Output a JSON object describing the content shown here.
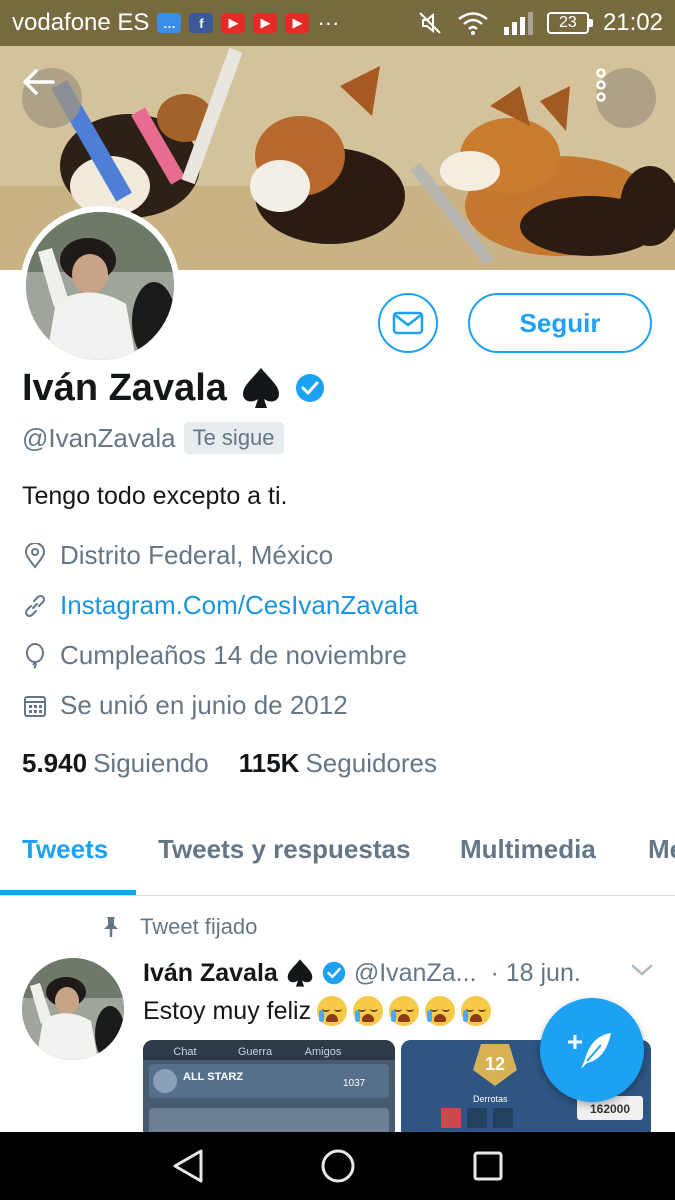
{
  "status_bar": {
    "carrier": "vodafone ES",
    "more": "···",
    "battery": "23",
    "time": "21:02",
    "notification_icons": [
      "messages-icon",
      "facebook-icon",
      "youtube-icon",
      "youtube-icon",
      "youtube-icon"
    ]
  },
  "profile": {
    "name": "Iván Zavala",
    "handle": "@IvanZavala",
    "follows_you": "Te sigue",
    "bio": "Tengo todo excepto a ti.",
    "follow_label": "Seguir",
    "location": "Distrito Federal, México",
    "website": "Instagram.Com/CesIvanZavala",
    "birthday": "Cumpleaños 14 de noviembre",
    "joined": "Se unió en junio de 2012",
    "following_count": "5.940",
    "following_label": "Siguiendo",
    "followers_count": "115K",
    "followers_label": "Seguidores"
  },
  "tabs": [
    {
      "label": "Tweets",
      "active": true
    },
    {
      "label": "Tweets y respuestas",
      "active": false
    },
    {
      "label": "Multimedia",
      "active": false
    },
    {
      "label": "Me",
      "active": false
    }
  ],
  "pinned_tweet": {
    "pinned_label": "Tweet fijado",
    "name": "Iván Zavala",
    "handle": "@IvanZa...",
    "date": "· 18 jun.",
    "text": "Estoy muy feliz",
    "emoji_count": 5,
    "media": {
      "game_tabs": [
        "Chat",
        "Guerra",
        "Amigos"
      ],
      "clan_name": "ALL STARZ",
      "trophies": "1037",
      "level": "12",
      "defeats_label": "Derrotas",
      "gold": "162000"
    }
  },
  "colors": {
    "accent": "#1da1f2",
    "status_bar": "#776a3f",
    "secondary_text": "#657786",
    "link": "#1b95e0"
  }
}
